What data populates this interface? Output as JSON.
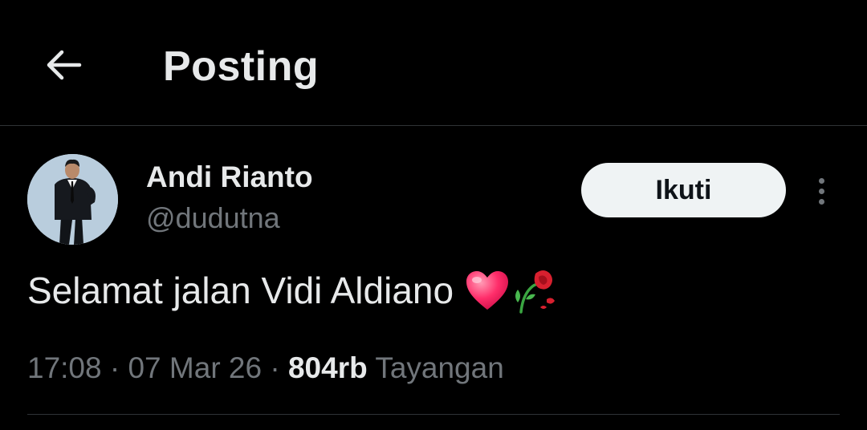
{
  "header": {
    "title": "Posting",
    "back_icon": "arrow-left-icon"
  },
  "author": {
    "display_name": "Andi Rianto",
    "handle": "@dudutna",
    "avatar_icon": "avatar-photo"
  },
  "follow_button": {
    "label": "Ikuti"
  },
  "more_icon": "more-vertical-icon",
  "post": {
    "text": "Selamat jalan Vidi Aldiano",
    "emojis": [
      "heart-emoji-icon",
      "wilted-rose-emoji-icon"
    ]
  },
  "meta": {
    "time": "17:08",
    "separator": " · ",
    "date": "07 Mar 26",
    "views_count": "804rb",
    "views_label": "Tayangan"
  },
  "colors": {
    "background": "#000000",
    "text_primary": "#e7e9ea",
    "text_secondary": "#71767b",
    "border": "#2f3336",
    "button_bg": "#eff3f4",
    "button_text": "#0f1419"
  }
}
